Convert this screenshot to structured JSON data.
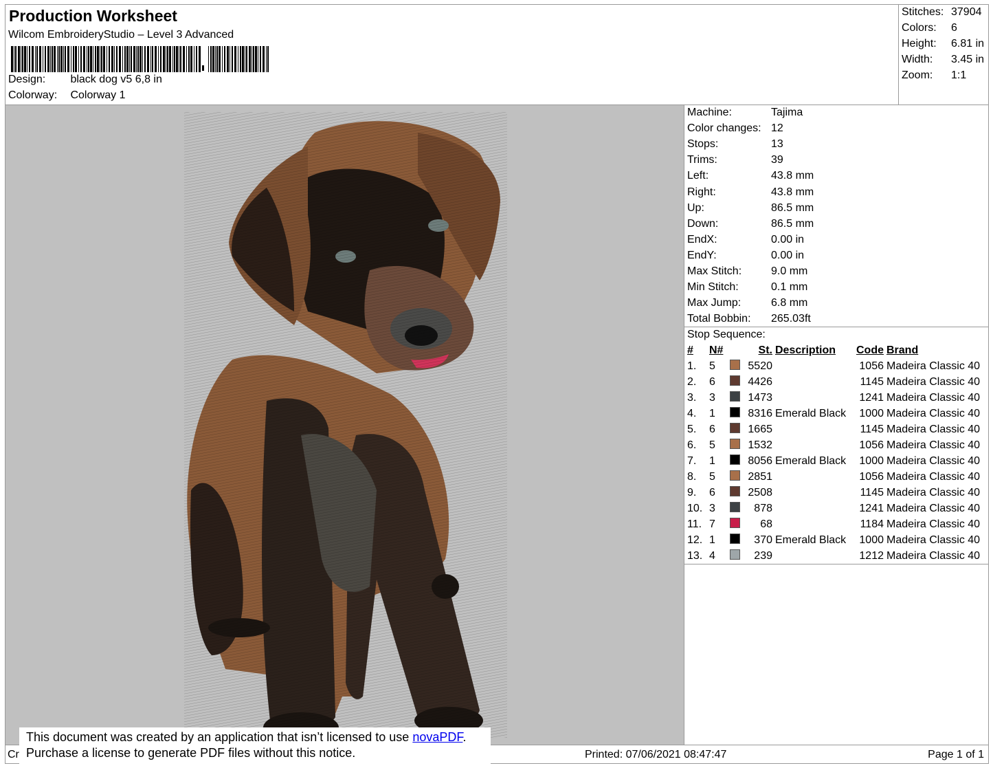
{
  "header": {
    "title": "Production Worksheet",
    "software": "Wilcom EmbroideryStudio – Level 3 Advanced",
    "design_label": "Design:",
    "design_value": "black dog v5 6,8 in",
    "colorway_label": "Colorway:",
    "colorway_value": "Colorway 1"
  },
  "stats": [
    {
      "label": "Stitches:",
      "value": "37904"
    },
    {
      "label": "Colors:",
      "value": "6"
    },
    {
      "label": "Height:",
      "value": "6.81 in"
    },
    {
      "label": "Width:",
      "value": "3.45 in"
    },
    {
      "label": "Zoom:",
      "value": "1:1"
    }
  ],
  "machine_info": [
    {
      "label": "Machine:",
      "value": "Tajima"
    },
    {
      "label": "Color changes:",
      "value": "12"
    },
    {
      "label": "Stops:",
      "value": "13"
    },
    {
      "label": "Trims:",
      "value": "39"
    },
    {
      "label": "Left:",
      "value": "43.8 mm"
    },
    {
      "label": "Right:",
      "value": "43.8 mm"
    },
    {
      "label": "Up:",
      "value": "86.5 mm"
    },
    {
      "label": "Down:",
      "value": "86.5 mm"
    },
    {
      "label": "EndX:",
      "value": "0.00 in"
    },
    {
      "label": "EndY:",
      "value": "0.00 in"
    },
    {
      "label": "Max Stitch:",
      "value": "9.0 mm"
    },
    {
      "label": "Min Stitch:",
      "value": "0.1 mm"
    },
    {
      "label": "Max Jump:",
      "value": "6.8 mm"
    },
    {
      "label": "Total Bobbin:",
      "value": "265.03ft"
    }
  ],
  "stop_sequence": {
    "heading": "Stop Sequence:",
    "columns": {
      "index": "#",
      "needle": "N#",
      "stitches": "St.",
      "description": "Description",
      "code": "Code",
      "brand": "Brand"
    },
    "rows": [
      {
        "index": "1.",
        "needle": "5",
        "color": "#a8704a",
        "stitches": "5520",
        "description": "",
        "code": "1056",
        "brand": "Madeira Classic 40"
      },
      {
        "index": "2.",
        "needle": "6",
        "color": "#5e3a30",
        "stitches": "4426",
        "description": "",
        "code": "1145",
        "brand": "Madeira Classic 40"
      },
      {
        "index": "3.",
        "needle": "3",
        "color": "#3c4144",
        "stitches": "1473",
        "description": "",
        "code": "1241",
        "brand": "Madeira Classic 40"
      },
      {
        "index": "4.",
        "needle": "1",
        "color": "#000000",
        "stitches": "8316",
        "description": "Emerald Black",
        "code": "1000",
        "brand": "Madeira Classic 40"
      },
      {
        "index": "5.",
        "needle": "6",
        "color": "#5e3a30",
        "stitches": "1665",
        "description": "",
        "code": "1145",
        "brand": "Madeira Classic 40"
      },
      {
        "index": "6.",
        "needle": "5",
        "color": "#a8704a",
        "stitches": "1532",
        "description": "",
        "code": "1056",
        "brand": "Madeira Classic 40"
      },
      {
        "index": "7.",
        "needle": "1",
        "color": "#000000",
        "stitches": "8056",
        "description": "Emerald Black",
        "code": "1000",
        "brand": "Madeira Classic 40"
      },
      {
        "index": "8.",
        "needle": "5",
        "color": "#a8704a",
        "stitches": "2851",
        "description": "",
        "code": "1056",
        "brand": "Madeira Classic 40"
      },
      {
        "index": "9.",
        "needle": "6",
        "color": "#5e3a30",
        "stitches": "2508",
        "description": "",
        "code": "1145",
        "brand": "Madeira Classic 40"
      },
      {
        "index": "10.",
        "needle": "3",
        "color": "#3c4144",
        "stitches": "878",
        "description": "",
        "code": "1241",
        "brand": "Madeira Classic 40"
      },
      {
        "index": "11.",
        "needle": "7",
        "color": "#c81e4a",
        "stitches": "68",
        "description": "",
        "code": "1184",
        "brand": "Madeira Classic 40"
      },
      {
        "index": "12.",
        "needle": "1",
        "color": "#000000",
        "stitches": "370",
        "description": "Emerald Black",
        "code": "1000",
        "brand": "Madeira Classic 40"
      },
      {
        "index": "13.",
        "needle": "4",
        "color": "#9ea6a9",
        "stitches": "239",
        "description": "",
        "code": "1212",
        "brand": "Madeira Classic 40"
      }
    ]
  },
  "footer": {
    "left_text": "Cr",
    "printed": "Printed: 07/06/2021 08:47:47",
    "page": "Page 1 of 1"
  },
  "notice": {
    "line1_prefix": "This document was created by an application that isn’t licensed to use ",
    "link": "novaPDF",
    "line1_suffix": ".",
    "line2": "Purchase a license to generate PDF files without this notice."
  },
  "colors": {
    "preview_background": "#c0c0c0",
    "border": "#9a9a9a",
    "link": "#0000ee"
  }
}
